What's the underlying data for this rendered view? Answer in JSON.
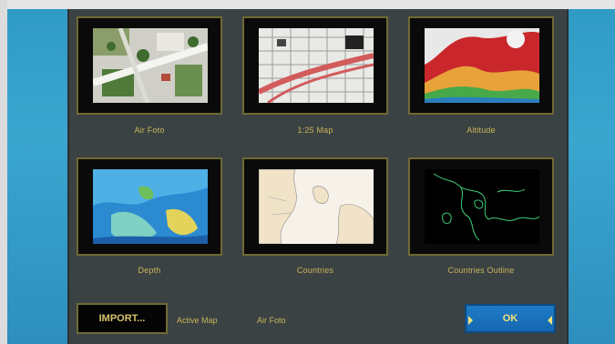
{
  "maps": [
    {
      "label": "Air Foto"
    },
    {
      "label": "1:25 Map"
    },
    {
      "label": "Altitude"
    },
    {
      "label": "Depth"
    },
    {
      "label": "Countries"
    },
    {
      "label": "Countries Outline"
    }
  ],
  "footer": {
    "import_label": "IMPORT...",
    "active_map_label": "Active Map",
    "active_map_value": "Air Foto",
    "ok_label": "OK"
  },
  "colors": {
    "panel": "#3b4243",
    "tile_border": "#6f6a34",
    "caption": "#c9b55a",
    "ok_button": "#1e7cc6",
    "background": "#3aa6cf"
  }
}
